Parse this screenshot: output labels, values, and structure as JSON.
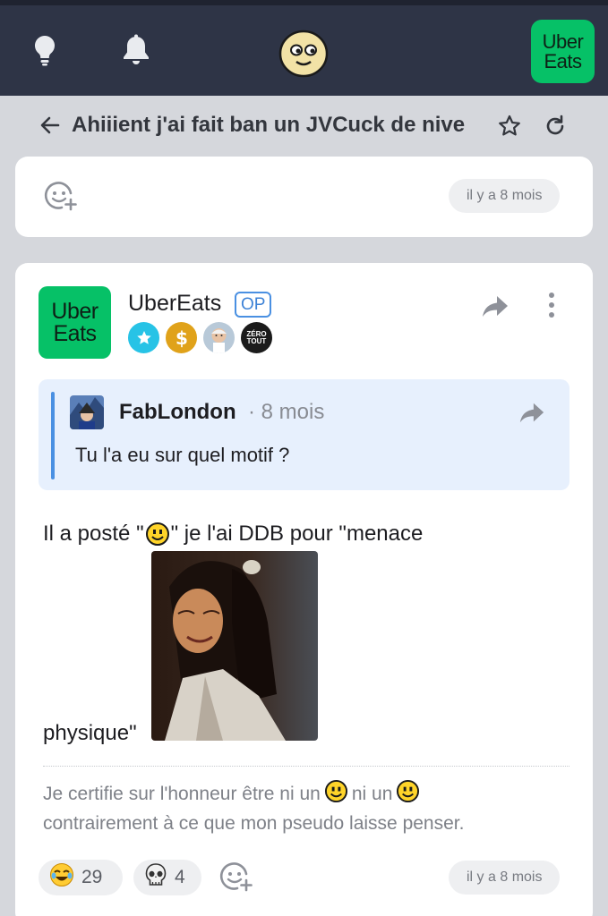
{
  "nav": {
    "brand_line1": "Uber",
    "brand_line2": "Eats",
    "colors": {
      "bar": "#2e3446",
      "brand_green": "#06c167"
    }
  },
  "topic": {
    "title": "Ahiiient j'ai fait ban un JVCuck de nive"
  },
  "first_card": {
    "time": "il y a 8 mois"
  },
  "post": {
    "author": "UberEats",
    "op_label": "OP",
    "logo_line1": "Uber",
    "logo_line2": "Eats",
    "badges": [
      "star-badge",
      "dollar-badge",
      "harold-badge",
      "zero-tout-badge"
    ],
    "zero_badge_line1": "ZÉRO",
    "zero_badge_line2": "TOUT",
    "quote": {
      "author": "FabLondon",
      "time": "· 8 mois",
      "text": "Tu l'a eu sur quel motif ?"
    },
    "body_before_smiley": "Il a posté \"",
    "body_after_smiley": "\" je l'ai DDB pour \"menace",
    "body_line2": "physique\"",
    "signature_part1": "Je certifie sur l'honneur être ni un",
    "signature_part2": "ni un",
    "signature_part3": "contrairement à ce que mon pseudo laisse penser.",
    "reactions": [
      {
        "icon": "laughing-emoji-icon",
        "count": "29"
      },
      {
        "icon": "skull-emoji-icon",
        "count": "4"
      }
    ],
    "time": "il y a 8 mois"
  }
}
